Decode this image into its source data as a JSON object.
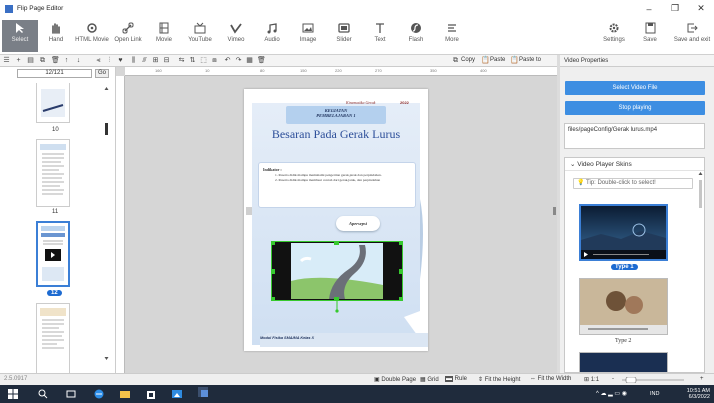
{
  "window": {
    "title": "Flip Page Editor",
    "minimize": "–",
    "maximize": "❐",
    "close": "✕"
  },
  "ribbon": [
    {
      "id": "select",
      "label": "Select"
    },
    {
      "id": "hand",
      "label": "Hand"
    },
    {
      "id": "html",
      "label": "HTML Movie"
    },
    {
      "id": "openlink",
      "label": "Open Link"
    },
    {
      "id": "movie",
      "label": "Movie"
    },
    {
      "id": "youtube",
      "label": "YouTube"
    },
    {
      "id": "vimeo",
      "label": "Vimeo"
    },
    {
      "id": "audio",
      "label": "Audio"
    },
    {
      "id": "image",
      "label": "Image"
    },
    {
      "id": "slider",
      "label": "Slider"
    },
    {
      "id": "text",
      "label": "Text"
    },
    {
      "id": "flash",
      "label": "Flash"
    },
    {
      "id": "more",
      "label": "More"
    },
    {
      "id": "settings",
      "label": "Settings"
    },
    {
      "id": "save",
      "label": "Save"
    },
    {
      "id": "saveexit",
      "label": "Save and exit"
    }
  ],
  "toolbar2": {
    "copy": "Copy",
    "paste": "Paste",
    "paste_to": "Paste to"
  },
  "properties_title": "Video Properties",
  "pages": {
    "pager_value": "12/121",
    "go": "Go",
    "labels": [
      "10",
      "11",
      "12"
    ]
  },
  "ruler_ticks": [
    "160",
    "10",
    "80",
    "150",
    "220",
    "270",
    "350",
    "400"
  ],
  "doc": {
    "school": "Kinematika Gerak",
    "year": "2022",
    "subtitle1": "KEGIATAN",
    "subtitle2": "PEMBELAJARAN 1",
    "heading": "Besaran Pada Gerak Lurus",
    "indikator_title": "Indikator :",
    "items": [
      "Peserta didik mampu memahami pengertian gerak,jarak dan perpindahan.",
      "Peserta didik mampu membuat contoh dari gerak,jarak, dan perpindahan"
    ],
    "apersepsi": "Apersepsi",
    "footer": "Modul Fisika SMA/MA Kelas X"
  },
  "right": {
    "select_video": "Select Video File",
    "stop_playing": "Stop playing",
    "path": "files/pageConfig/Gerak lurus.mp4",
    "skins_title": "Video Player Skins",
    "tip": "Tip: Double-click to select!",
    "type1": "Type 1",
    "type2": "Type 2"
  },
  "status": {
    "left": "2.5.0917",
    "double_page": "Double Page",
    "grid": "Grid",
    "rule": "Rule",
    "fit_height": "Fit the Height",
    "fit_width": "Fit the Width",
    "zoom": "1:1",
    "zoom_minus": "-",
    "zoom_plus": "+"
  },
  "tray": {
    "lang": "IND",
    "time": "10:51 AM",
    "date": "6/3/2022"
  },
  "colors": {
    "accent": "#3d8ee2",
    "selection": "#3b7fd6",
    "taskbar": "#1f2b3c"
  }
}
